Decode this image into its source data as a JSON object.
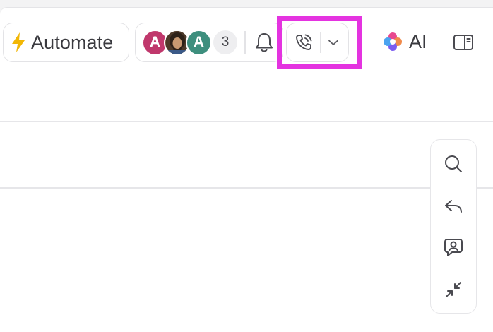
{
  "toolbar": {
    "automate_label": "Automate",
    "people": {
      "avatars": [
        {
          "initial": "A",
          "color": "#c0386c"
        },
        {
          "initial": "",
          "kind": "photo"
        },
        {
          "initial": "A",
          "color": "#3e8f7e"
        }
      ],
      "extra_count": "3"
    },
    "ai_label": "AI"
  },
  "colors": {
    "highlight": "#e433e0",
    "automate_bolt": "#f2b705",
    "border": "#e3e3e6"
  },
  "icons": {
    "automate": "lightning-bolt-icon",
    "notifications": "bell-icon",
    "call": "phone-call-icon",
    "call_menu": "chevron-down-icon",
    "ai": "ai-sparkle-icon",
    "panel": "sidebar-panel-icon",
    "rail": [
      "search-icon",
      "reply-icon",
      "chat-user-icon",
      "collapse-arrows-icon"
    ]
  }
}
